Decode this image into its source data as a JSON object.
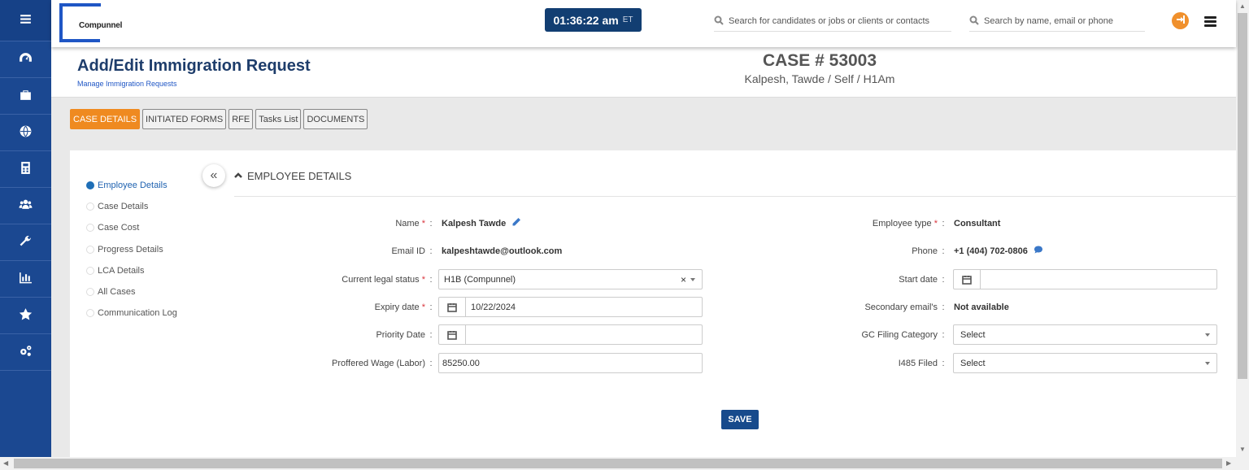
{
  "nav": {
    "items": [
      "menu-icon",
      "dashboard-icon",
      "briefcase-icon",
      "globe-icon",
      "calculator-icon",
      "users-icon",
      "wrench-icon",
      "bar-chart-icon",
      "star-icon",
      "gears-icon"
    ]
  },
  "header": {
    "logo_text": "Compunnel",
    "clock_time": "01:36:22 am",
    "clock_tz": "ET",
    "search1_placeholder": "Search for candidates or jobs or clients or contacts",
    "search2_placeholder": "Search by name, email or phone",
    "logout_color": "#f0902c"
  },
  "page": {
    "title": "Add/Edit Immigration Request",
    "subtitle": "Manage Immigration Requests",
    "case_number": "CASE # 53003",
    "case_person": "Kalpesh, Tawde / Self / H1Am"
  },
  "tabs": [
    {
      "label": "CASE DETAILS",
      "active": true
    },
    {
      "label": "INITIATED FORMS",
      "active": false
    },
    {
      "label": "RFE",
      "active": false
    },
    {
      "label": "Tasks List",
      "active": false
    },
    {
      "label": "DOCUMENTS",
      "active": false
    }
  ],
  "sidenav": [
    {
      "label": "Employee Details",
      "active": true
    },
    {
      "label": "Case Details",
      "active": false
    },
    {
      "label": "Case Cost",
      "active": false
    },
    {
      "label": "Progress Details",
      "active": false
    },
    {
      "label": "LCA Details",
      "active": false
    },
    {
      "label": "All Cases",
      "active": false
    },
    {
      "label": "Communication Log",
      "active": false
    }
  ],
  "section": {
    "title": "EMPLOYEE DETAILS"
  },
  "form": {
    "name_label": "Name",
    "name_value": "Kalpesh Tawde",
    "email_label": "Email ID",
    "email_value": "kalpeshtawde@outlook.com",
    "legal_status_label": "Current legal status",
    "legal_status_value": "H1B (Compunnel)",
    "expiry_label": "Expiry date",
    "expiry_value": "10/22/2024",
    "priority_label": "Priority Date",
    "priority_value": "",
    "wage_label": "Proffered Wage (Labor)",
    "wage_value": "85250.00",
    "emp_type_label": "Employee type",
    "emp_type_value": "Consultant",
    "phone_label": "Phone",
    "phone_value": "+1 (404) 702-0806",
    "start_label": "Start date",
    "start_value": "",
    "sec_email_label": "Secondary email's",
    "sec_email_value": "Not available",
    "gc_label": "GC Filing Category",
    "gc_value": "Select",
    "i485_label": "I485 Filed",
    "i485_value": "Select",
    "required_mark": "*",
    "colon": ":",
    "clear_mark": "×"
  },
  "save_label": "SAVE",
  "colors": {
    "nav_bg": "#1b4891",
    "accent_tab": "#ef8a20",
    "save_bg": "#174a8c",
    "clock_bg": "#123e72"
  }
}
